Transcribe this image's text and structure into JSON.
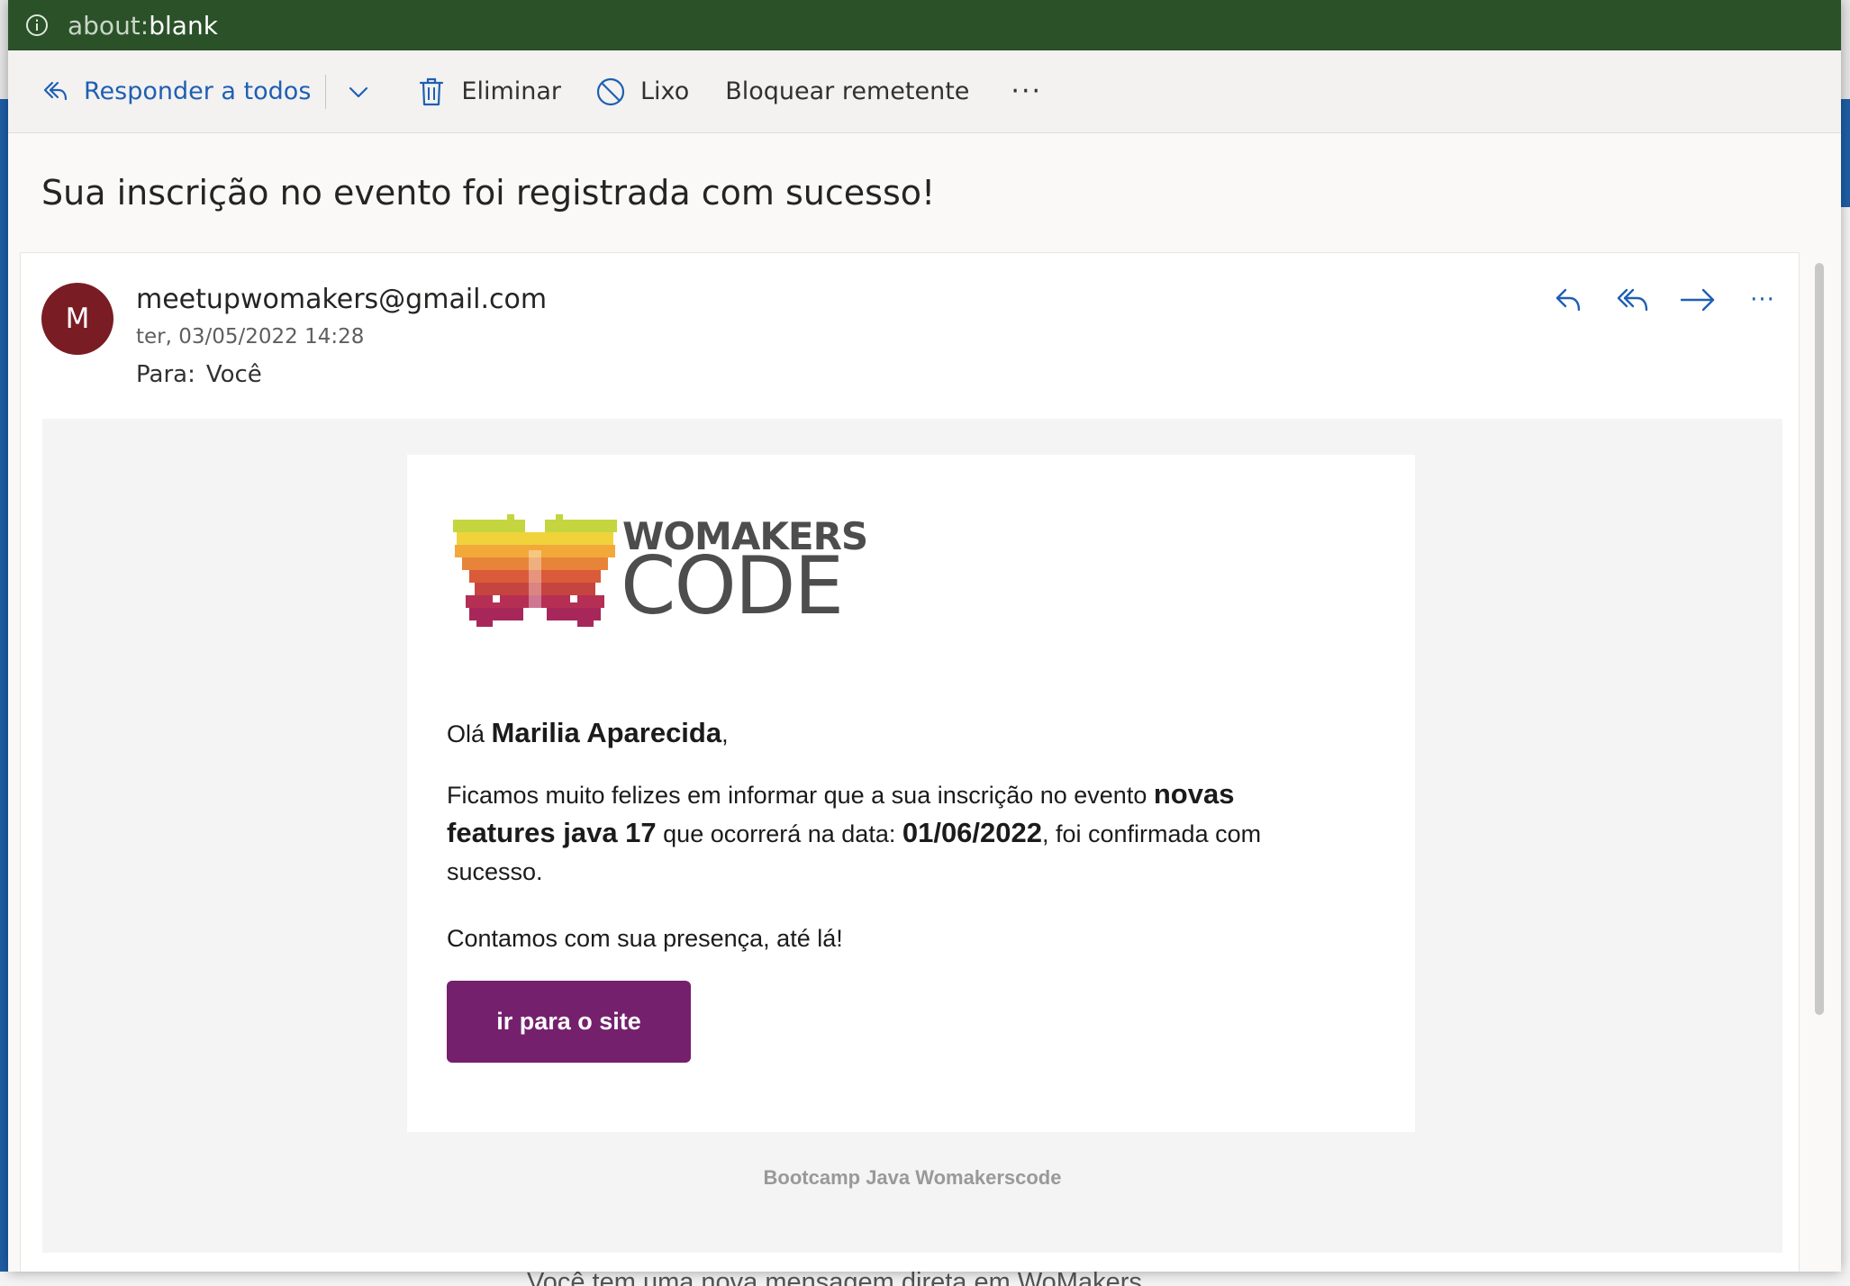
{
  "browser": {
    "url_prefix": "about:",
    "url_main": "blank"
  },
  "toolbar": {
    "reply_all_label": "Responder a todos",
    "delete_label": "Eliminar",
    "junk_label": "Lixo",
    "block_label": "Bloquear remetente",
    "more_label": "···"
  },
  "message": {
    "subject": "Sua inscrição no evento foi registrada com sucesso!",
    "avatar_initial": "M",
    "sender": "meetupwomakers@gmail.com",
    "date": "ter, 03/05/2022 14:28",
    "to_label": "Para:",
    "to_value": "Você",
    "more_actions": "···"
  },
  "email": {
    "logo_line1": "WOMAKERS",
    "logo_line2": "CODE",
    "greeting_prefix": "Olá ",
    "recipient_name": "Marilia Aparecida",
    "greeting_suffix": ",",
    "para1_part1": "Ficamos muito felizes em informar que a sua inscrição no evento ",
    "event_name": "novas features java 17",
    "para1_part2": " que ocorrerá na data: ",
    "event_date": "01/06/2022",
    "para1_part3": ", foi confirmada com sucesso.",
    "para2": "Contamos com sua presença, até lá!",
    "cta_label": "ir para o site",
    "footer": "Bootcamp Java Womakerscode"
  },
  "background": {
    "partial_text": "Você tem uma nova mensagem direta em WoMakers"
  },
  "colors": {
    "url_bar": "#2a5128",
    "accent_blue": "#1f5fb3",
    "avatar": "#7a1c24",
    "cta": "#74206c"
  }
}
